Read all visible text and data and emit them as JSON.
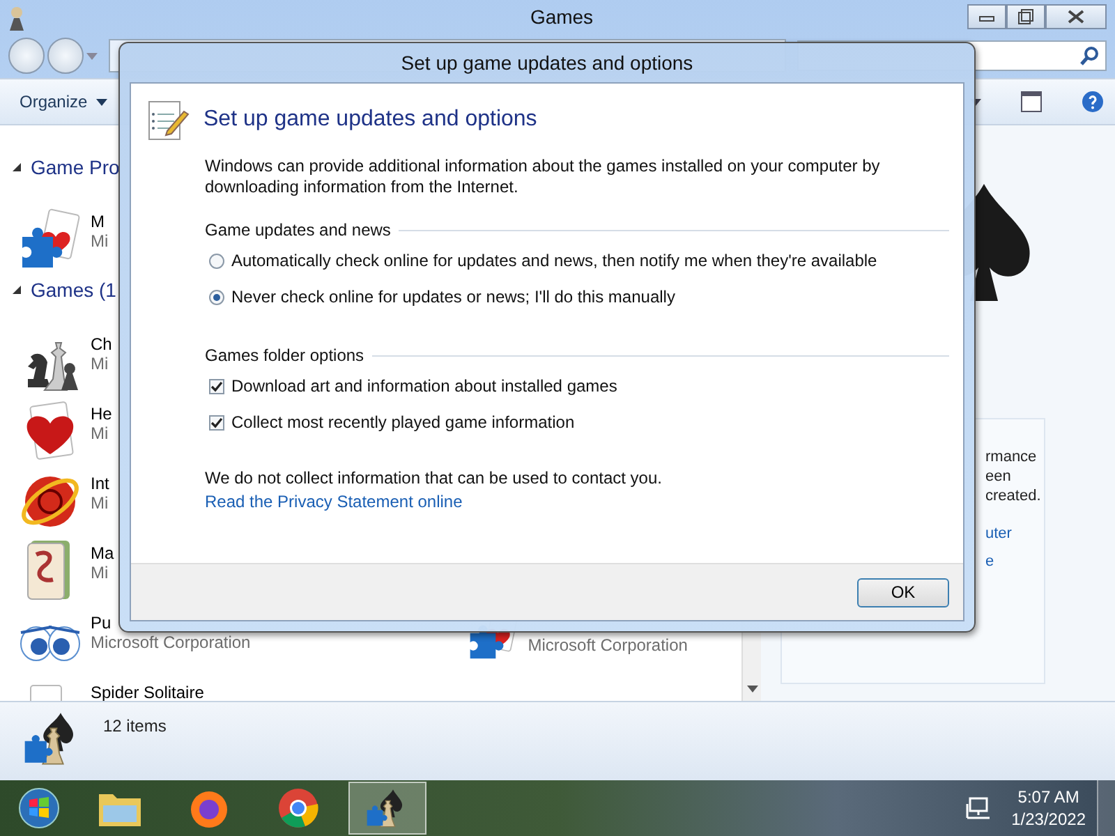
{
  "explorer": {
    "title": "Games",
    "organize": "Organize",
    "groups": [
      {
        "label": "Game Pro",
        "expanded": true,
        "items": [
          {
            "name": "M",
            "publisher": "Mi"
          }
        ]
      },
      {
        "label": "Games (1",
        "expanded": true,
        "items": [
          {
            "name": "Ch",
            "publisher": "Mi"
          },
          {
            "name": "He",
            "publisher": "Mi"
          },
          {
            "name": "Int",
            "publisher": "Mi"
          },
          {
            "name": "Ma",
            "publisher": "Mi"
          },
          {
            "name": "Pu",
            "publisher": "Microsoft Corporation",
            "neighbor": {
              "publisher": "Microsoft Corporation"
            }
          },
          {
            "name": "Spider Solitaire"
          }
        ]
      }
    ],
    "details": {
      "lines": [
        "rmance",
        "een created."
      ],
      "links": [
        "uter",
        "e"
      ]
    },
    "status": "12 items"
  },
  "dialog": {
    "title": "Set up game updates and options",
    "heading": "Set up game updates and options",
    "description": "Windows can provide additional information about the games installed on your computer by downloading information from the Internet.",
    "sections": [
      {
        "label": "Game updates and news",
        "kind": "radio",
        "options": [
          {
            "label": "Automatically check online for updates and news, then notify me when they're available",
            "selected": false
          },
          {
            "label": "Never check online for updates or news; I'll do this manually",
            "selected": true
          }
        ]
      },
      {
        "label": "Games folder options",
        "kind": "checkbox",
        "options": [
          {
            "label": "Download art and information about installed games",
            "checked": true
          },
          {
            "label": "Collect most recently played game information",
            "checked": true
          }
        ]
      }
    ],
    "note": "We do not collect information that can be used to contact you.",
    "link": "Read the Privacy Statement online",
    "button": "OK"
  },
  "taskbar": {
    "items": [
      {
        "selected": false
      },
      {
        "selected": false
      },
      {
        "selected": false
      },
      {
        "selected": true
      }
    ],
    "time": "5:07 AM",
    "date": "1/23/2022"
  }
}
